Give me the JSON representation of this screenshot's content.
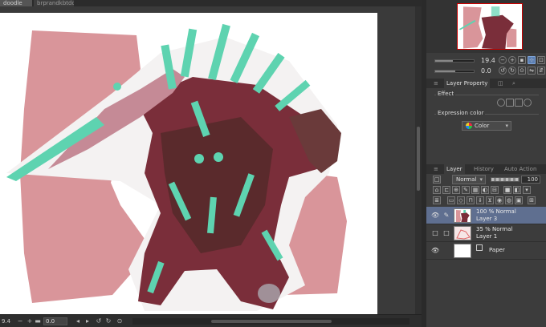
{
  "tabs": [
    {
      "label": "doodle"
    },
    {
      "label": "brprandkbtdon"
    }
  ],
  "canvas": {
    "bg_color": "#3a3a3a",
    "paper_color": "#ffffff",
    "accent_pink": "#d9959a",
    "crystal_color": "#5ed3b0",
    "body_color": "#7a2e3a"
  },
  "statusbar": {
    "zoom": "9.4",
    "rotation": "0.0"
  },
  "navigator": {
    "zoom_value": "19.4",
    "rotate_value": "0.0"
  },
  "property_tabs": {
    "layer_property": "Layer Property"
  },
  "layer_property": {
    "effect_label": "Effect",
    "expression_label": "Expression color",
    "expression_value": "Color"
  },
  "layer_panel_tabs": {
    "layer": "Layer",
    "history": "History",
    "auto_action": "Auto Action"
  },
  "layer_panel": {
    "blend_mode": "Normal",
    "opacity": "100"
  },
  "layers": [
    {
      "mode": "100 % Normal",
      "name": "Layer 3",
      "selected": true
    },
    {
      "mode": "35 % Normal",
      "name": "Layer 1",
      "selected": false
    },
    {
      "mode": "",
      "name": "Paper",
      "selected": false
    }
  ]
}
